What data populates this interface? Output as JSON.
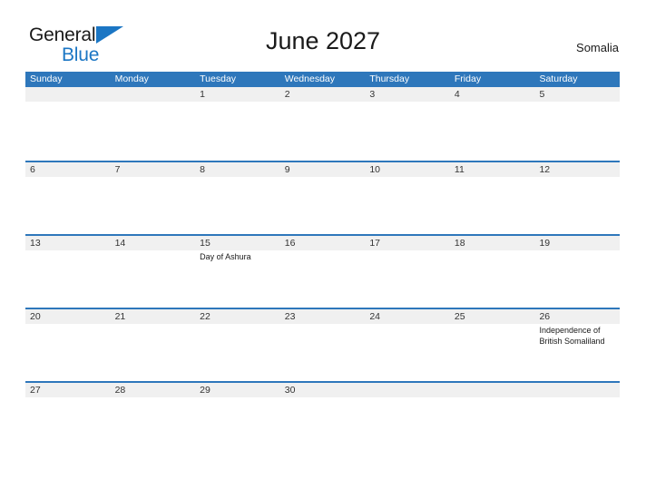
{
  "brand": {
    "word_one": "General",
    "word_two": "Blue",
    "flag_icon": "triangle-flag-icon",
    "color_primary": "#1b76c4",
    "color_text": "#1a1a1a"
  },
  "header": {
    "title": "June 2027",
    "locale": "Somalia"
  },
  "theme": {
    "header_blue": "#2e77bb",
    "band_gray": "#f0f0f0",
    "text_dark": "#333333"
  },
  "calendar": {
    "weekdays": [
      "Sunday",
      "Monday",
      "Tuesday",
      "Wednesday",
      "Thursday",
      "Friday",
      "Saturday"
    ],
    "weeks": [
      [
        {
          "day": "",
          "events": []
        },
        {
          "day": "",
          "events": []
        },
        {
          "day": "1",
          "events": []
        },
        {
          "day": "2",
          "events": []
        },
        {
          "day": "3",
          "events": []
        },
        {
          "day": "4",
          "events": []
        },
        {
          "day": "5",
          "events": []
        }
      ],
      [
        {
          "day": "6",
          "events": []
        },
        {
          "day": "7",
          "events": []
        },
        {
          "day": "8",
          "events": []
        },
        {
          "day": "9",
          "events": []
        },
        {
          "day": "10",
          "events": []
        },
        {
          "day": "11",
          "events": []
        },
        {
          "day": "12",
          "events": []
        }
      ],
      [
        {
          "day": "13",
          "events": []
        },
        {
          "day": "14",
          "events": []
        },
        {
          "day": "15",
          "events": [
            "Day of Ashura"
          ]
        },
        {
          "day": "16",
          "events": []
        },
        {
          "day": "17",
          "events": []
        },
        {
          "day": "18",
          "events": []
        },
        {
          "day": "19",
          "events": []
        }
      ],
      [
        {
          "day": "20",
          "events": []
        },
        {
          "day": "21",
          "events": []
        },
        {
          "day": "22",
          "events": []
        },
        {
          "day": "23",
          "events": []
        },
        {
          "day": "24",
          "events": []
        },
        {
          "day": "25",
          "events": []
        },
        {
          "day": "26",
          "events": [
            "Independence of British Somaliland"
          ]
        }
      ],
      [
        {
          "day": "27",
          "events": []
        },
        {
          "day": "28",
          "events": []
        },
        {
          "day": "29",
          "events": []
        },
        {
          "day": "30",
          "events": []
        },
        {
          "day": "",
          "events": []
        },
        {
          "day": "",
          "events": []
        },
        {
          "day": "",
          "events": []
        }
      ]
    ]
  }
}
